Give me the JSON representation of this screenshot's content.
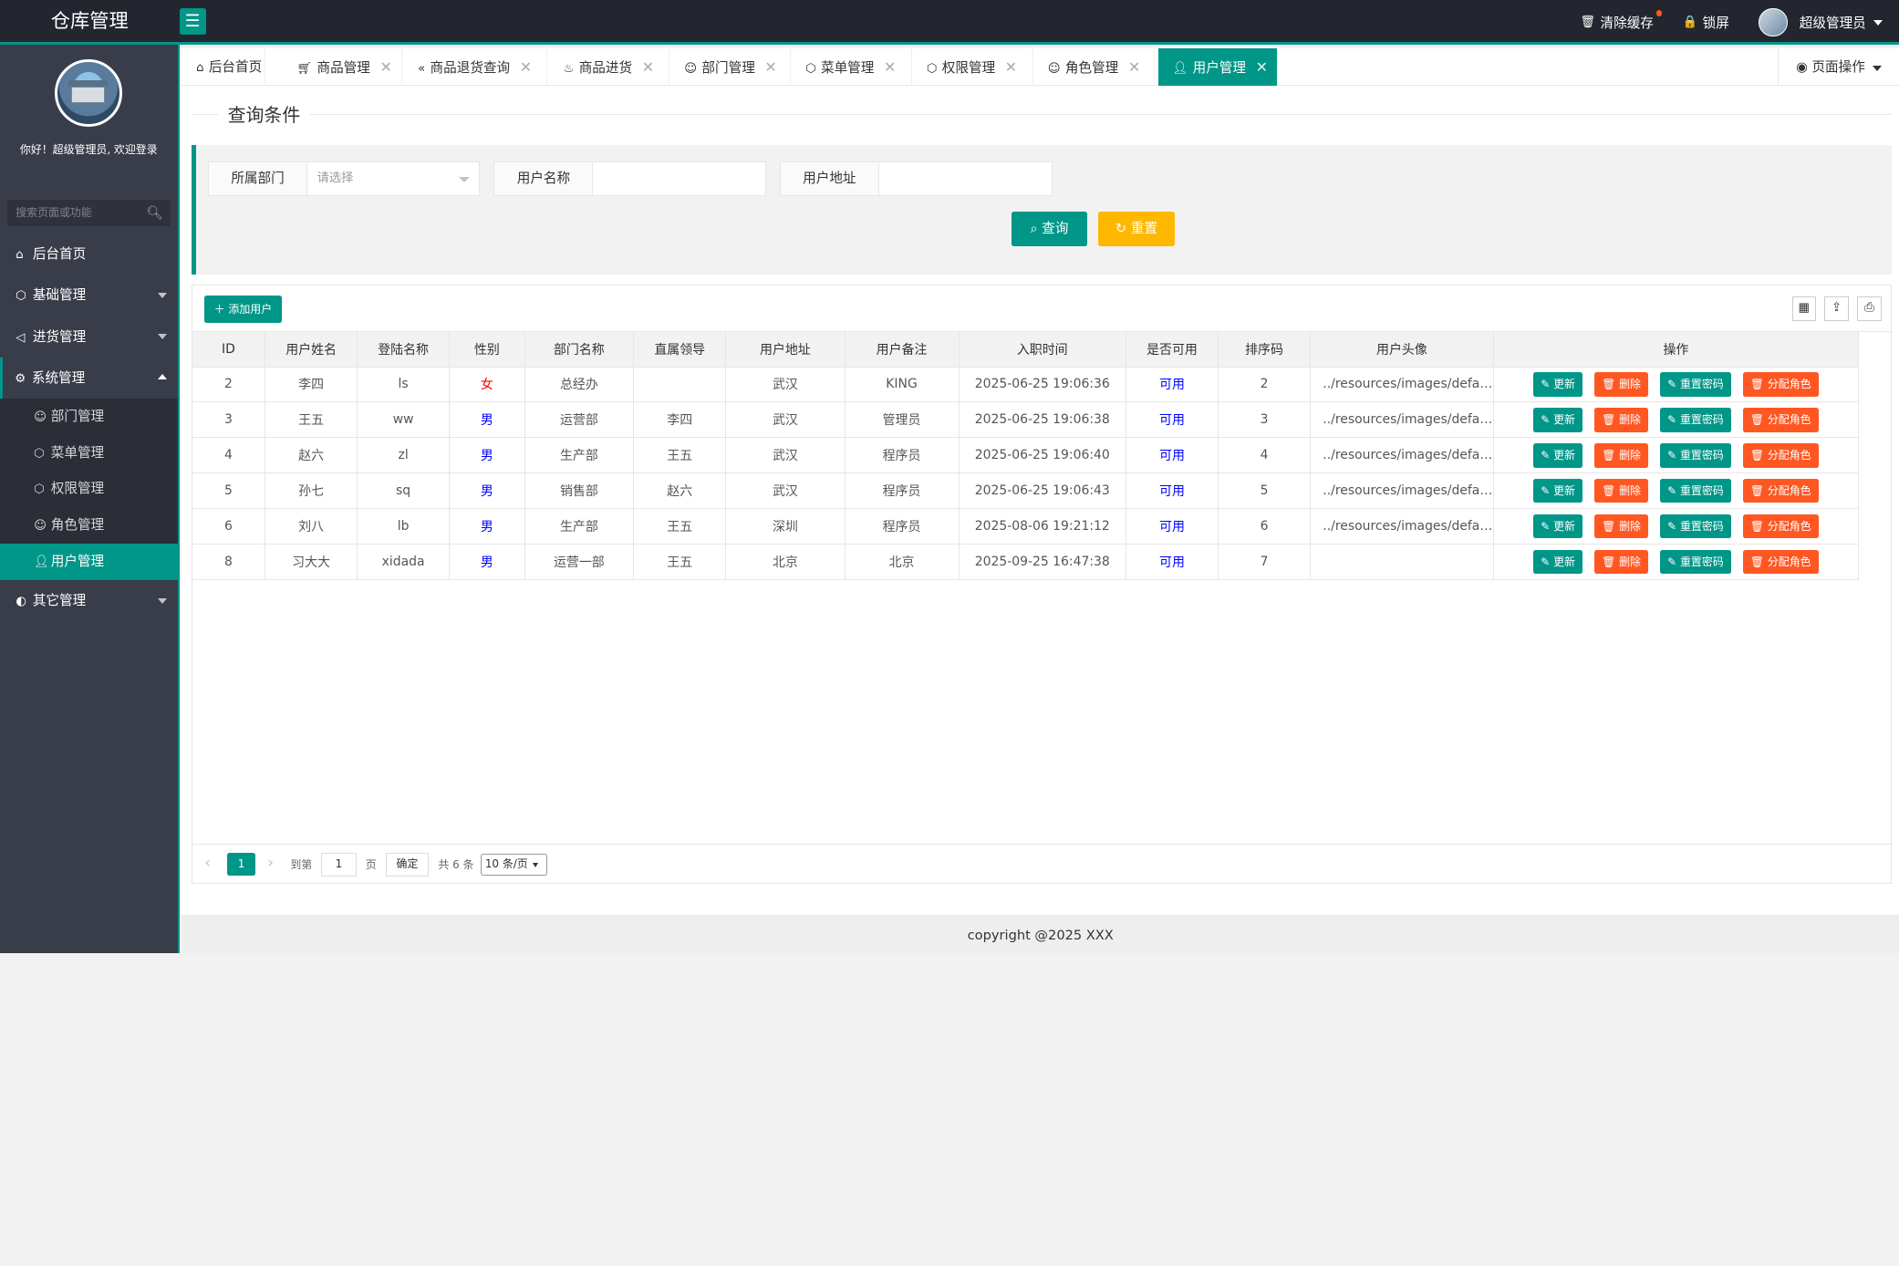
{
  "app": {
    "title": "仓库管理"
  },
  "topbar": {
    "clear_cache": "清除缓存",
    "lock_screen": "锁屏",
    "user": "超级管理员"
  },
  "sidebar": {
    "welcome": "你好！超级管理员, 欢迎登录",
    "search_placeholder": "搜索页面或功能",
    "items": [
      {
        "label": "后台首页"
      },
      {
        "label": "基础管理"
      },
      {
        "label": "进货管理"
      },
      {
        "label": "系统管理"
      }
    ],
    "sub_items": [
      {
        "label": "部门管理"
      },
      {
        "label": "菜单管理"
      },
      {
        "label": "权限管理"
      },
      {
        "label": "角色管理"
      },
      {
        "label": "用户管理"
      }
    ],
    "other": "其它管理"
  },
  "tabs": [
    {
      "label": "后台首页"
    },
    {
      "label": "商品管理"
    },
    {
      "label": "商品退货查询"
    },
    {
      "label": "商品进货"
    },
    {
      "label": "部门管理"
    },
    {
      "label": "菜单管理"
    },
    {
      "label": "权限管理"
    },
    {
      "label": "角色管理"
    },
    {
      "label": "用户管理"
    }
  ],
  "page_ops": "页面操作",
  "query": {
    "legend": "查询条件",
    "dept_label": "所属部门",
    "dept_placeholder": "请选择",
    "name_label": "用户名称",
    "addr_label": "用户地址",
    "search_btn": "查询",
    "reset_btn": "重置"
  },
  "table": {
    "add_btn": "添加用户",
    "headers": [
      "ID",
      "用户姓名",
      "登陆名称",
      "性别",
      "部门名称",
      "直属领导",
      "用户地址",
      "用户备注",
      "入职时间",
      "是否可用",
      "排序码",
      "用户头像",
      "操作"
    ],
    "rows": [
      {
        "id": "2",
        "name": "李四",
        "login": "ls",
        "sex": "女",
        "dept": "总经办",
        "leader": "",
        "addr": "武汉",
        "remark": "KING",
        "time": "2025-06-25 19:06:36",
        "avail": "可用",
        "order": "2",
        "avatar": "../resources/images/defaultusertitle.jpg"
      },
      {
        "id": "3",
        "name": "王五",
        "login": "ww",
        "sex": "男",
        "dept": "运营部",
        "leader": "李四",
        "addr": "武汉",
        "remark": "管理员",
        "time": "2025-06-25 19:06:38",
        "avail": "可用",
        "order": "3",
        "avatar": "../resources/images/defaultusertitle.jpg"
      },
      {
        "id": "4",
        "name": "赵六",
        "login": "zl",
        "sex": "男",
        "dept": "生产部",
        "leader": "王五",
        "addr": "武汉",
        "remark": "程序员",
        "time": "2025-06-25 19:06:40",
        "avail": "可用",
        "order": "4",
        "avatar": "../resources/images/defaultusertitle.jpg"
      },
      {
        "id": "5",
        "name": "孙七",
        "login": "sq",
        "sex": "男",
        "dept": "销售部",
        "leader": "赵六",
        "addr": "武汉",
        "remark": "程序员",
        "time": "2025-06-25 19:06:43",
        "avail": "可用",
        "order": "5",
        "avatar": "../resources/images/defaultusertitle.jpg"
      },
      {
        "id": "6",
        "name": "刘八",
        "login": "lb",
        "sex": "男",
        "dept": "生产部",
        "leader": "王五",
        "addr": "深圳",
        "remark": "程序员",
        "time": "2025-08-06 19:21:12",
        "avail": "可用",
        "order": "6",
        "avatar": "../resources/images/defaultusertitle.jpg"
      },
      {
        "id": "8",
        "name": "习大大",
        "login": "xidada",
        "sex": "男",
        "dept": "运营一部",
        "leader": "王五",
        "addr": "北京",
        "remark": "北京",
        "time": "2025-09-25 16:47:38",
        "avail": "可用",
        "order": "7",
        "avatar": ""
      }
    ],
    "ops": {
      "update": "更新",
      "delete": "删除",
      "reset_pwd": "重置密码",
      "assign_role": "分配角色"
    }
  },
  "pager": {
    "current": "1",
    "goto_label": "到第",
    "goto_value": "1",
    "page_unit": "页",
    "ok": "确定",
    "total": "共 6 条",
    "page_size": "10 条/页"
  },
  "footer": "copyright @2025 XXX",
  "colors": {
    "accent": "#009688",
    "danger": "#ff5722",
    "warn": "#ffb800",
    "sidebar": "#393d49",
    "topbar": "#23262e"
  }
}
